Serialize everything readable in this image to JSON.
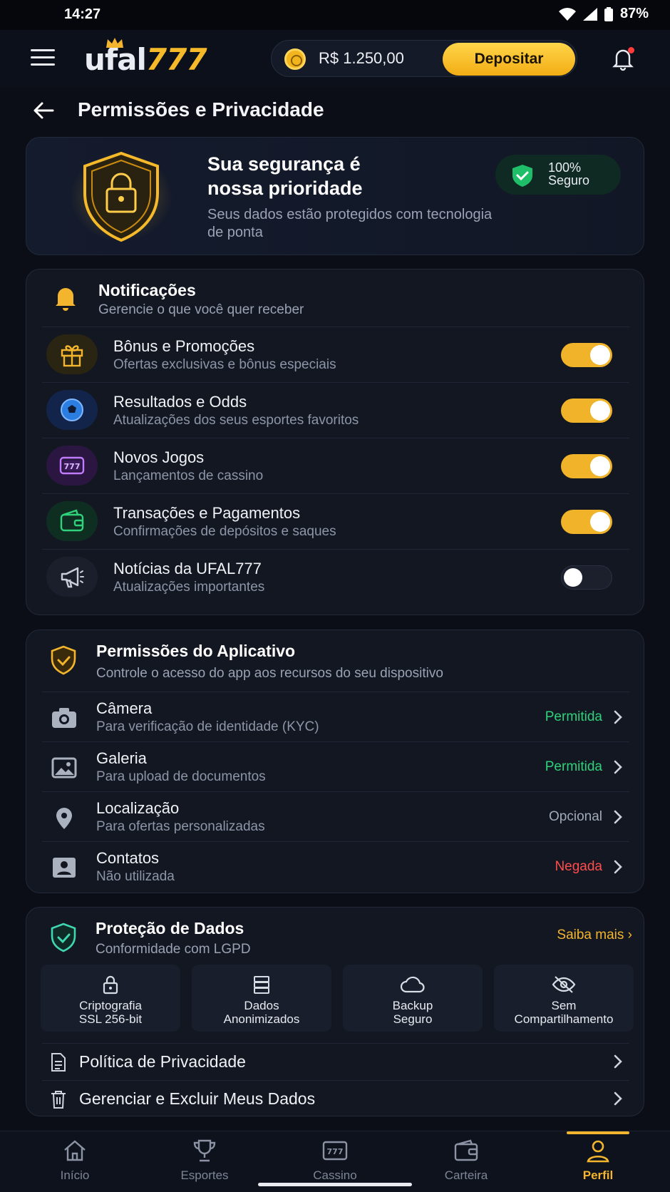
{
  "status": {
    "time": "14:27",
    "battery": "87%"
  },
  "header": {
    "logo_a": "ufal",
    "logo_b": "777",
    "balance": "R$ 1.250,00",
    "deposit_label": "Depositar"
  },
  "page": {
    "title": "Permissões e Privacidade"
  },
  "hero": {
    "title": "Sua segurança é nossa prioridade",
    "subtitle": "Seus dados estão protegidos com tecnologia de ponta",
    "badge_line1": "100%",
    "badge_line2": "Seguro"
  },
  "notifications": {
    "title": "Notificações",
    "subtitle": "Gerencie o que você quer receber",
    "items": [
      {
        "title": "Bônus e Promoções",
        "subtitle": "Ofertas exclusivas e bônus especiais",
        "enabled": true,
        "icon": "gift-icon"
      },
      {
        "title": "Resultados e Odds",
        "subtitle": "Atualizações dos seus esportes favoritos",
        "enabled": true,
        "icon": "ball-icon"
      },
      {
        "title": "Novos Jogos",
        "subtitle": "Lançamentos de cassino",
        "enabled": true,
        "icon": "slot-icon"
      },
      {
        "title": "Transações e Pagamentos",
        "subtitle": "Confirmações de depósitos e saques",
        "enabled": true,
        "icon": "wallet-icon"
      },
      {
        "title": "Notícias da UFAL777",
        "subtitle": "Atualizações importantes",
        "enabled": false,
        "icon": "megaphone-icon"
      }
    ]
  },
  "permissions": {
    "title": "Permissões do Aplicativo",
    "subtitle": "Controle o acesso do app aos recursos do seu dispositivo",
    "items": [
      {
        "title": "Câmera",
        "subtitle": "Para verificação de identidade (KYC)",
        "status": "Permitida",
        "status_color": "#2fd27a",
        "icon": "camera-icon"
      },
      {
        "title": "Galeria",
        "subtitle": "Para upload de documentos",
        "status": "Permitida",
        "status_color": "#2fd27a",
        "icon": "image-icon"
      },
      {
        "title": "Localização",
        "subtitle": "Para ofertas personalizadas",
        "status": "Opcional",
        "status_color": "#a2a9b8",
        "icon": "location-icon"
      },
      {
        "title": "Contatos",
        "subtitle": "Não utilizada",
        "status": "Negada",
        "status_color": "#ff4d4d",
        "icon": "contacts-icon"
      }
    ]
  },
  "data_protection": {
    "title": "Proteção de Dados",
    "subtitle": "Conformidade com LGPD",
    "learn_more": "Saiba mais",
    "tiles": [
      {
        "line1": "Criptografia",
        "line2": "SSL 256-bit",
        "icon": "lock-icon"
      },
      {
        "line1": "Dados",
        "line2": "Anonimizados",
        "icon": "server-icon"
      },
      {
        "line1": "Backup",
        "line2": "Seguro",
        "icon": "cloud-icon"
      },
      {
        "line1": "Sem",
        "line2": "Compartilhamento",
        "icon": "eye-off-icon"
      }
    ],
    "links": [
      {
        "label": "Política de Privacidade",
        "icon": "document-icon"
      },
      {
        "label": "Gerenciar e Excluir Meus Dados",
        "icon": "trash-icon"
      }
    ]
  },
  "tabs": [
    {
      "label": "Início",
      "icon": "home-icon",
      "active": false
    },
    {
      "label": "Esportes",
      "icon": "trophy-icon",
      "active": false
    },
    {
      "label": "Cassino",
      "icon": "slot-icon",
      "active": false
    },
    {
      "label": "Carteira",
      "icon": "wallet-icon",
      "active": false
    },
    {
      "label": "Perfil",
      "icon": "user-icon",
      "active": true
    }
  ],
  "colors": {
    "accent": "#f3b52e",
    "background": "#0b0e17",
    "card": "#121722"
  }
}
